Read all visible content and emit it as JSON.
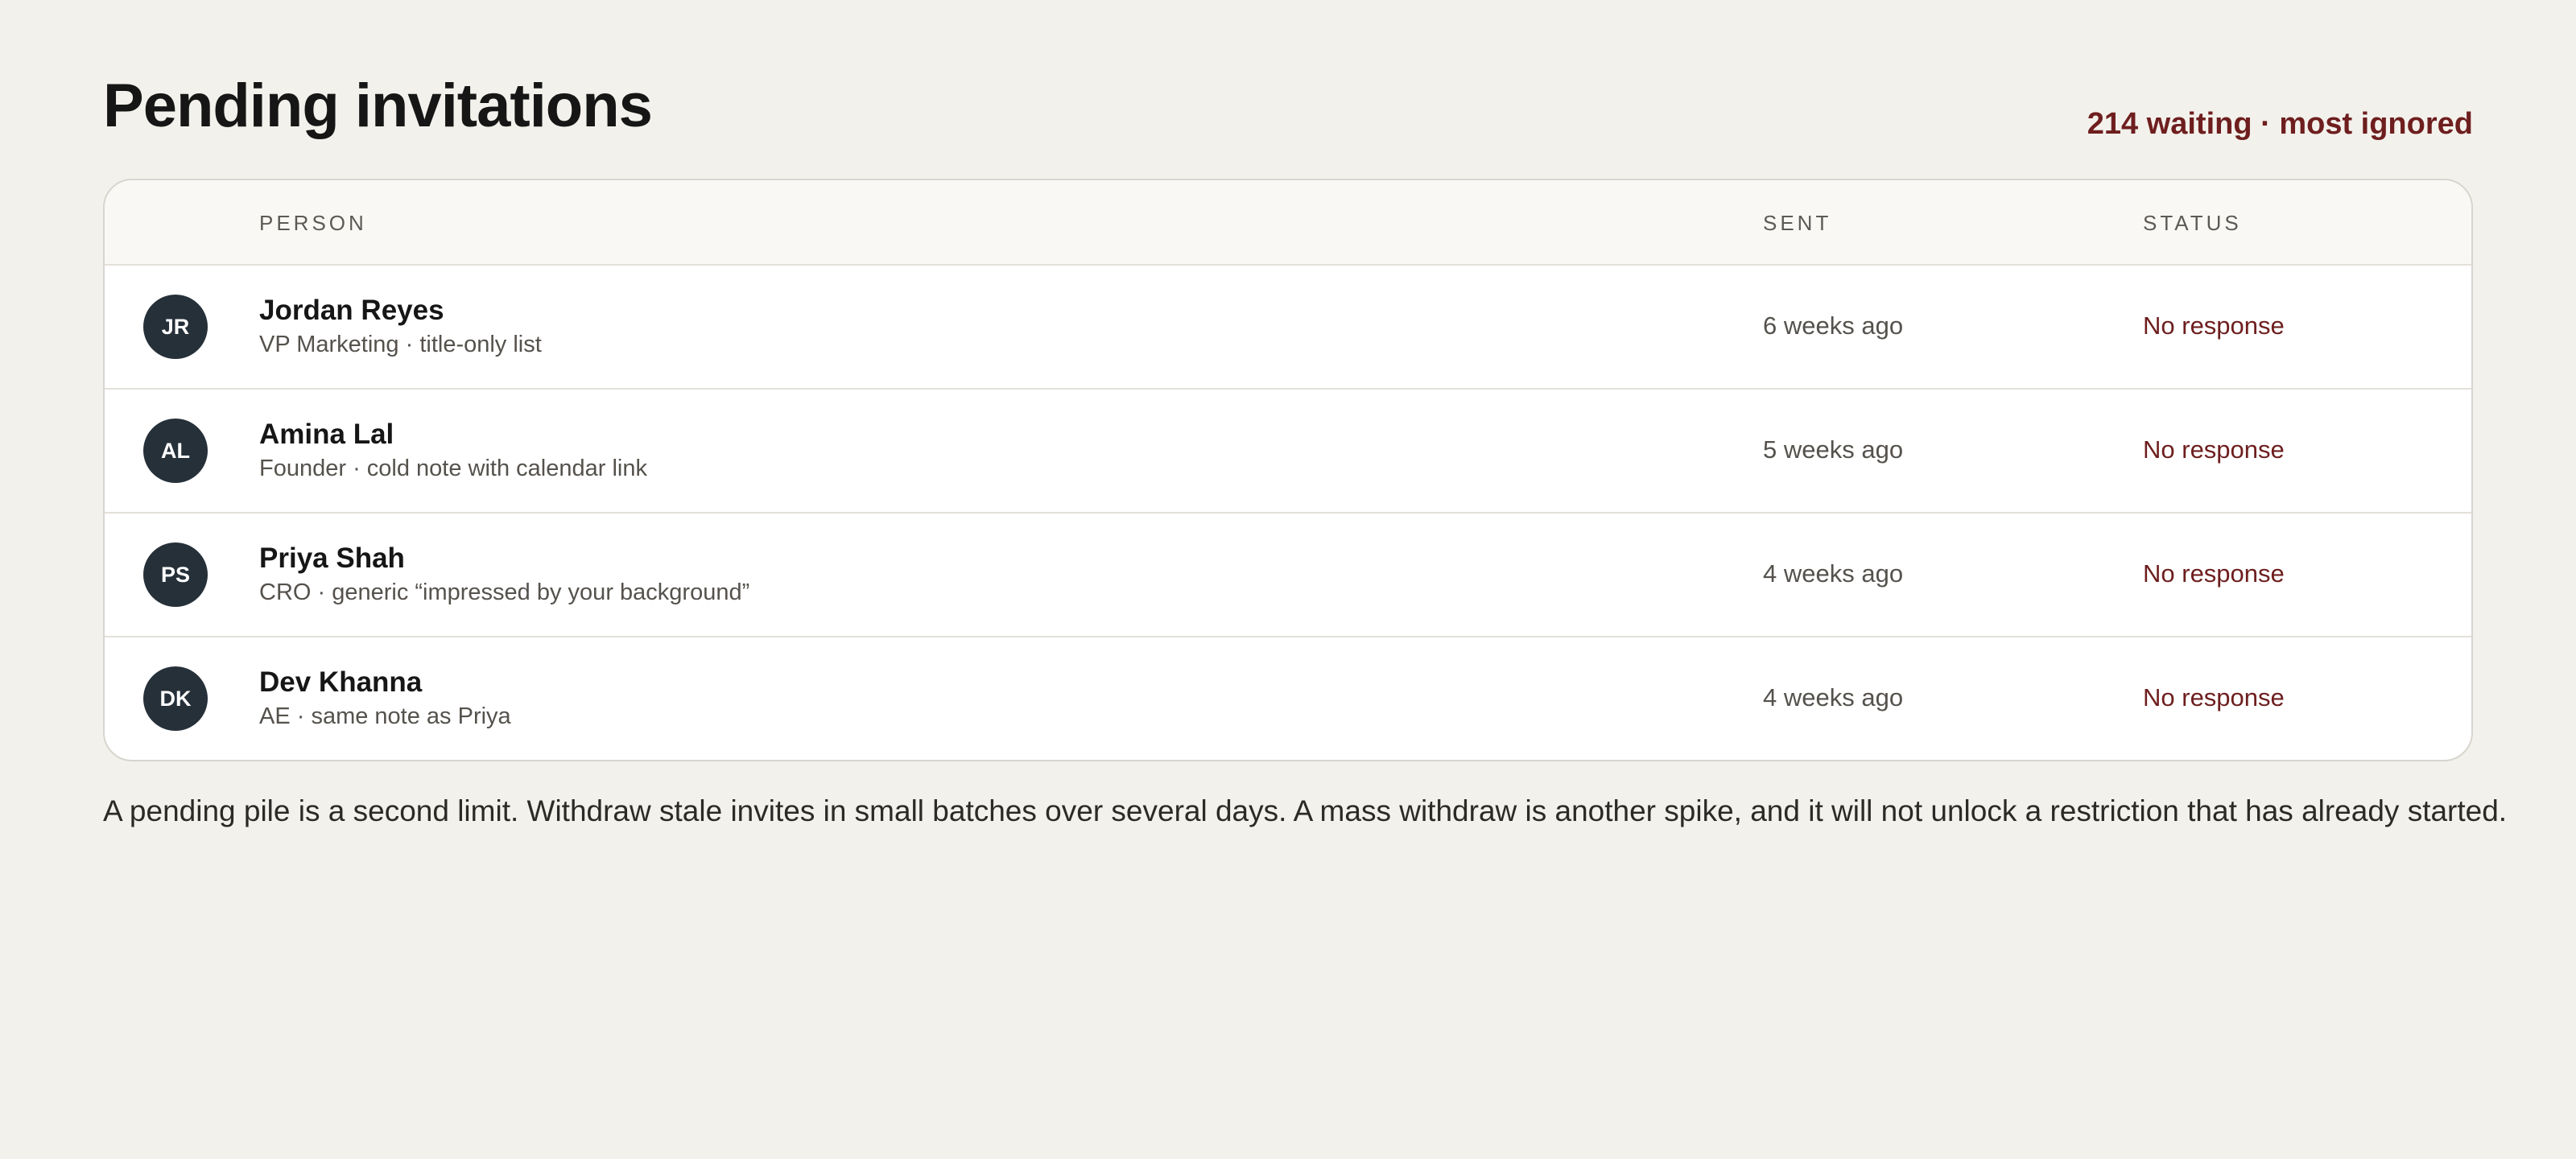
{
  "header": {
    "title": "Pending invitations",
    "summary": "214 waiting · most ignored"
  },
  "table": {
    "columns": {
      "person": "PERSON",
      "sent": "SENT",
      "status": "STATUS"
    },
    "rows": [
      {
        "initials": "JR",
        "name": "Jordan Reyes",
        "note": "VP Marketing · title-only list",
        "sent": "6 weeks ago",
        "status": "No response"
      },
      {
        "initials": "AL",
        "name": "Amina Lal",
        "note": "Founder · cold note with calendar link",
        "sent": "5 weeks ago",
        "status": "No response"
      },
      {
        "initials": "PS",
        "name": "Priya Shah",
        "note": "CRO · generic “impressed by your background”",
        "sent": "4 weeks ago",
        "status": "No response"
      },
      {
        "initials": "DK",
        "name": "Dev Khanna",
        "note": "AE · same note as Priya",
        "sent": "4 weeks ago",
        "status": "No response"
      }
    ]
  },
  "footer": {
    "note": "A pending pile is a second limit. Withdraw stale invites in small batches over several days. A mass withdraw is another spike, and it will not unlock a restriction that has already started."
  },
  "colors": {
    "background": "#f3f1ec",
    "accent": "#6e1e1e",
    "avatar": "#263039"
  }
}
